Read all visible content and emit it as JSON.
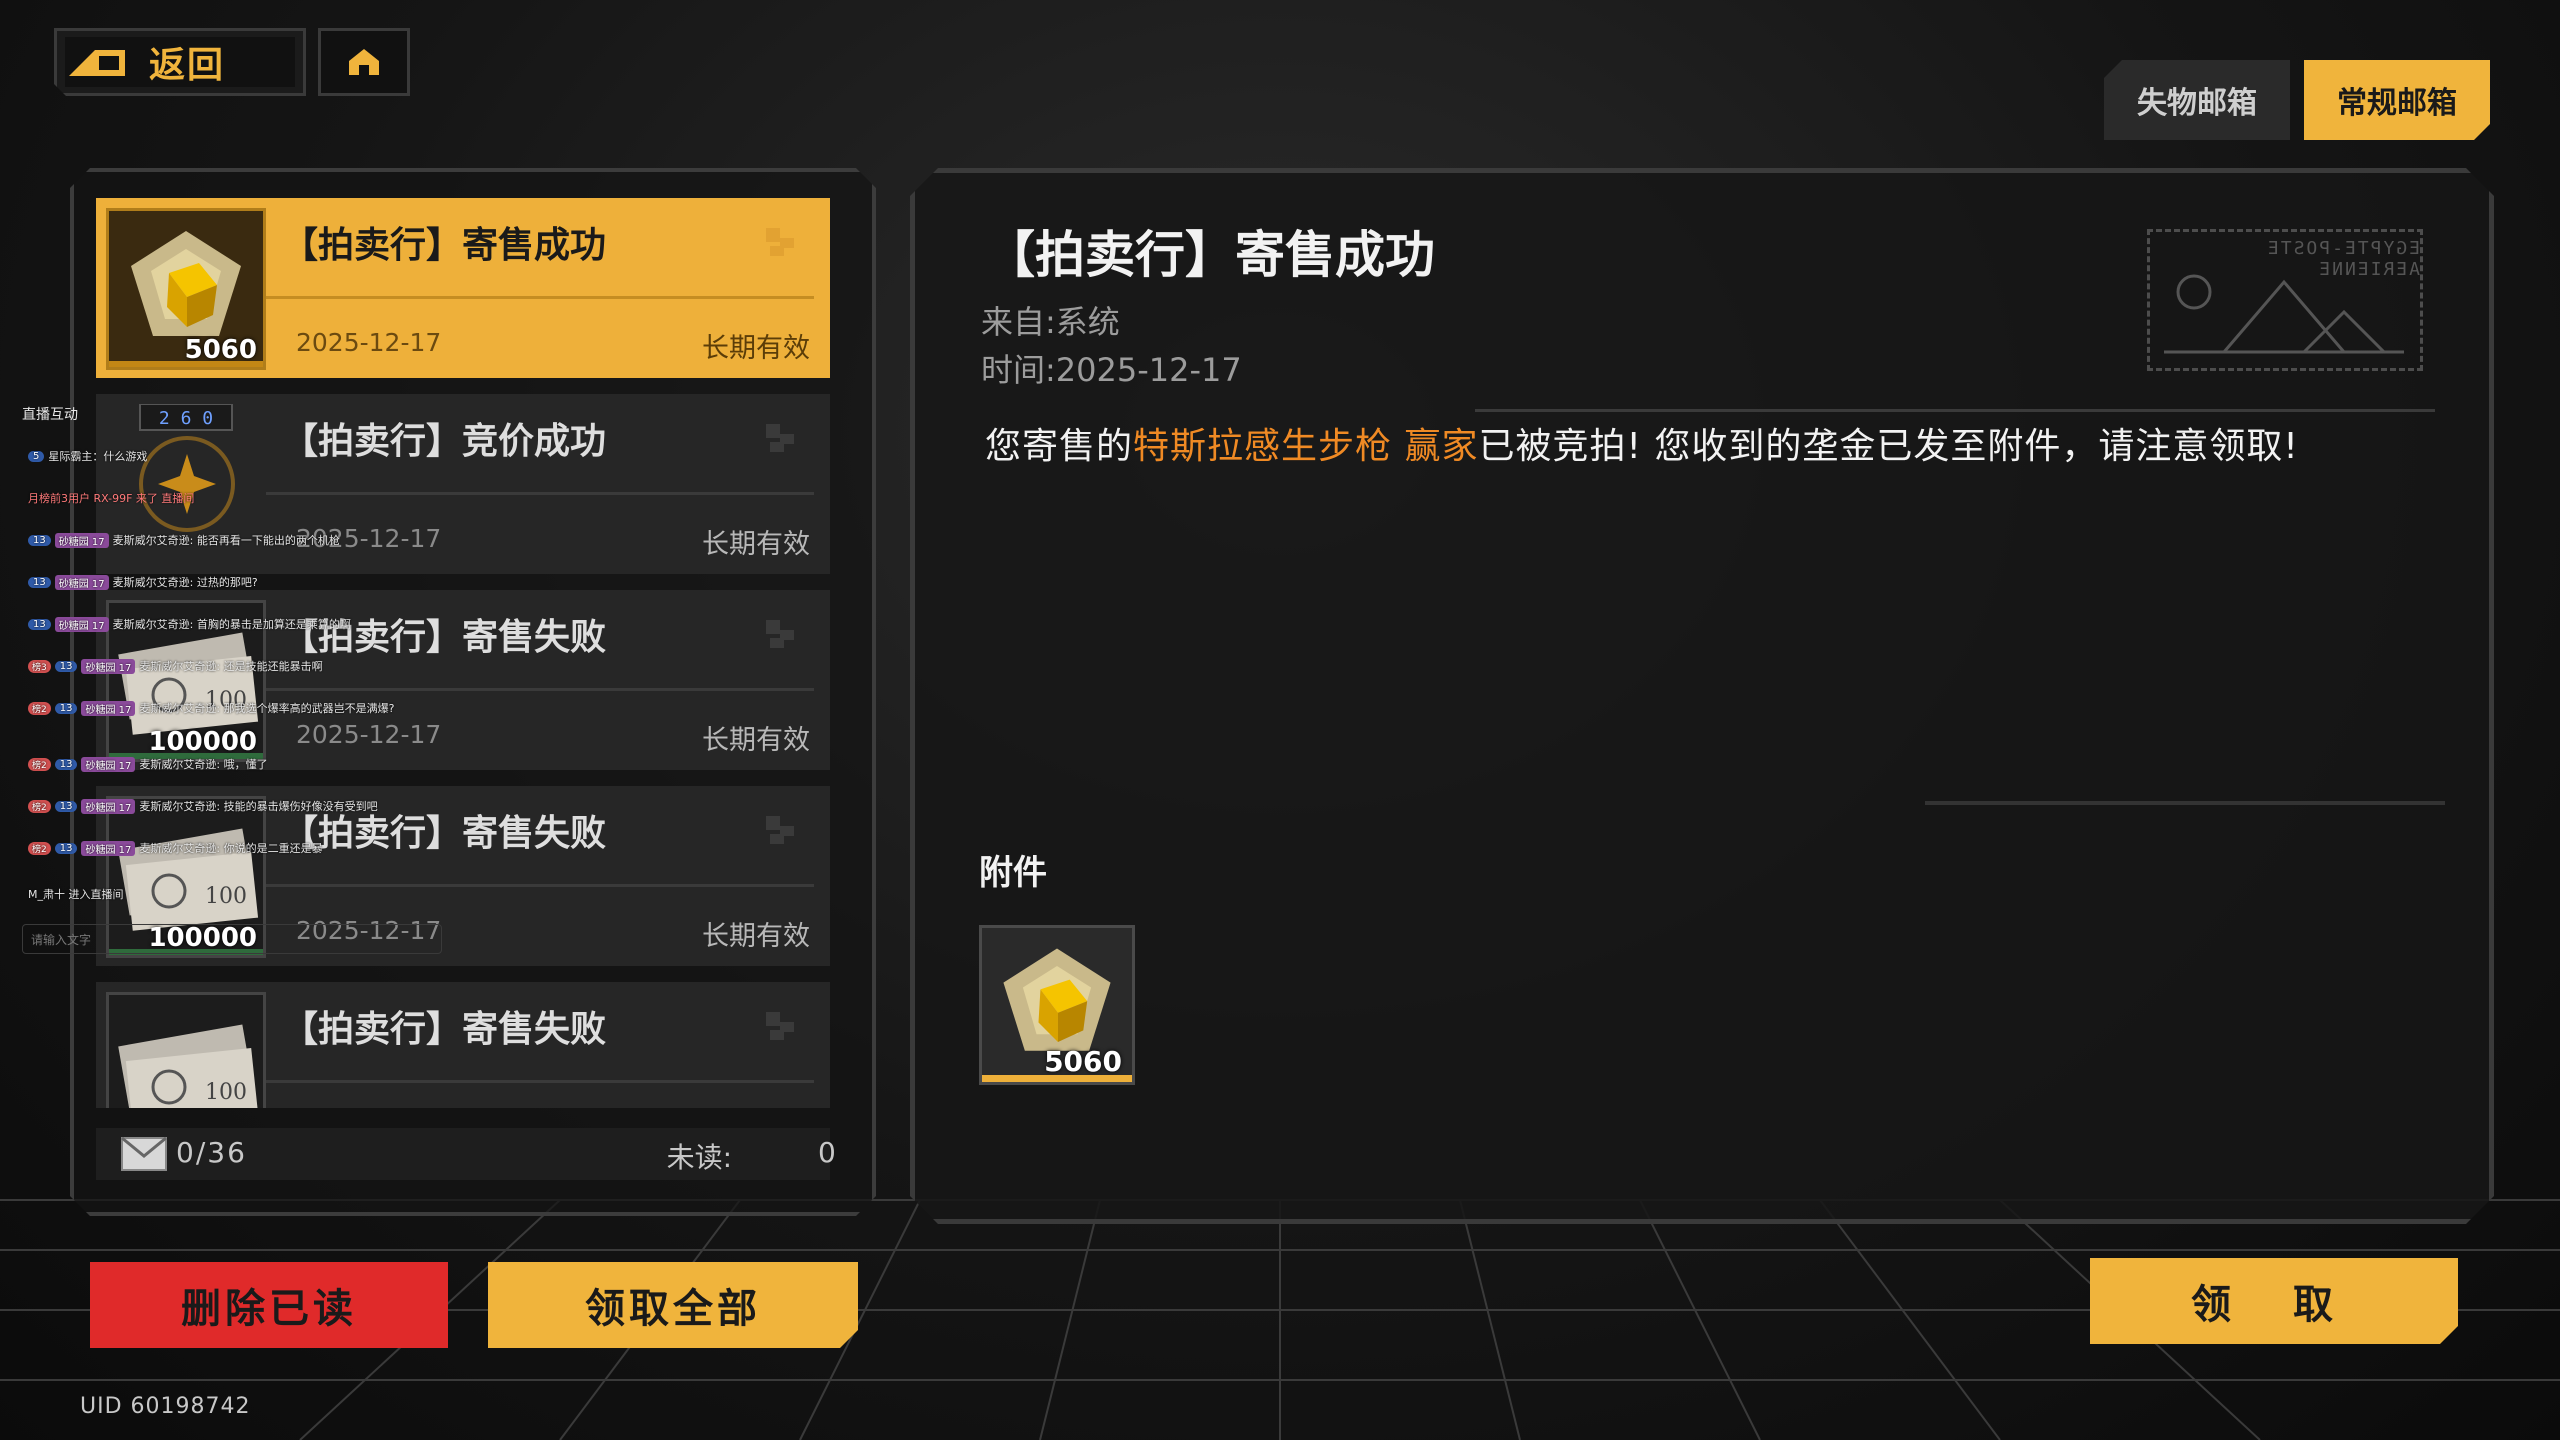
{
  "header": {
    "back_label": "返回",
    "home_icon": "home-icon"
  },
  "tabs": [
    {
      "label": "失物邮箱",
      "active": false
    },
    {
      "label": "常规邮箱",
      "active": true
    }
  ],
  "mail_list": {
    "items": [
      {
        "title": "【拍卖行】寄售成功",
        "date": "2025-12-17",
        "validity": "长期有效",
        "item_count": "5060",
        "item_icon": "gold-cube-icon",
        "active": true
      },
      {
        "title": "【拍卖行】竞价成功",
        "date": "2025-12-17",
        "validity": "长期有效",
        "item_count": "",
        "item_icon": "",
        "active": false
      },
      {
        "title": "【拍卖行】寄售失败",
        "date": "2025-12-17",
        "validity": "长期有效",
        "item_count": "100000",
        "item_icon": "banknote-icon",
        "active": false
      },
      {
        "title": "【拍卖行】寄售失败",
        "date": "2025-12-17",
        "validity": "长期有效",
        "item_count": "100000",
        "item_icon": "banknote-icon",
        "active": false
      },
      {
        "title": "【拍卖行】寄售失败",
        "date": "",
        "validity": "",
        "item_count": "",
        "item_icon": "banknote-icon",
        "active": false
      }
    ],
    "count_text": "0/36",
    "unread_label": "未读:",
    "unread_value": "0"
  },
  "detail": {
    "title": "【拍卖行】寄售成功",
    "from": "来自:系统",
    "time_label": "时间:",
    "time_value": "2025-12-17",
    "body_prefix": "您寄售的",
    "body_highlight": "特斯拉感生步枪 赢家",
    "body_suffix": "已被竞拍! 您收到的垄金已发至附件，请注意领取!",
    "attachment_label": "附件",
    "attachment_count": "5060",
    "stamp_text": "EGYPTE-POSTE AERIENNE"
  },
  "actions": {
    "delete_read": "删除已读",
    "claim_all": "领取全部",
    "claim": "领 取"
  },
  "uid": "UID 60198742",
  "chat_overlay": {
    "title": "直播互动",
    "lines": [
      {
        "level": "5",
        "fan": "",
        "role": "",
        "text": "星际霸主：什么游戏"
      },
      {
        "level": "",
        "fan": "",
        "role": "",
        "text": "月榜前3用户 RX-99F 来了 直播间",
        "red": true
      },
      {
        "level": "13",
        "fan": "砂糖园 17",
        "role": "",
        "text": "麦斯威尔艾奇逊: 能否再看一下能出的两个机枪"
      },
      {
        "level": "13",
        "fan": "砂糖园 17",
        "role": "",
        "text": "麦斯威尔艾奇逊: 过热的那吧?"
      },
      {
        "level": "13",
        "fan": "砂糖园 17",
        "role": "",
        "text": "麦斯威尔艾奇逊: 首胸的暴击是加算还是乘算的啊"
      },
      {
        "level": "13",
        "fan": "砂糖园 17",
        "role": "榜3",
        "text": "麦斯威尔艾奇逊: 还是技能还能暴击啊"
      },
      {
        "level": "13",
        "fan": "砂糖园 17",
        "role": "榜2",
        "text": "麦斯威尔艾奇逊: 那我选个爆率高的武器岂不是满爆?"
      },
      {
        "level": "13",
        "fan": "砂糖园 17",
        "role": "榜2",
        "text": "麦斯威尔艾奇逊: 哦，懂了"
      },
      {
        "level": "13",
        "fan": "砂糖园 17",
        "role": "榜2",
        "text": "麦斯威尔艾奇逊: 技能的暴击爆伤好像没有受到吧"
      },
      {
        "level": "13",
        "fan": "砂糖园 17",
        "role": "榜2",
        "text": "麦斯威尔艾奇逊: 你说的是二重还是暴"
      },
      {
        "level": "",
        "fan": "",
        "role": "",
        "text": "M_肃十 进入直播间"
      }
    ],
    "input_placeholder": "请输入文字"
  },
  "colors": {
    "accent": "#f0b43c",
    "danger": "#e02a2a",
    "highlight_text": "#f08a24"
  }
}
